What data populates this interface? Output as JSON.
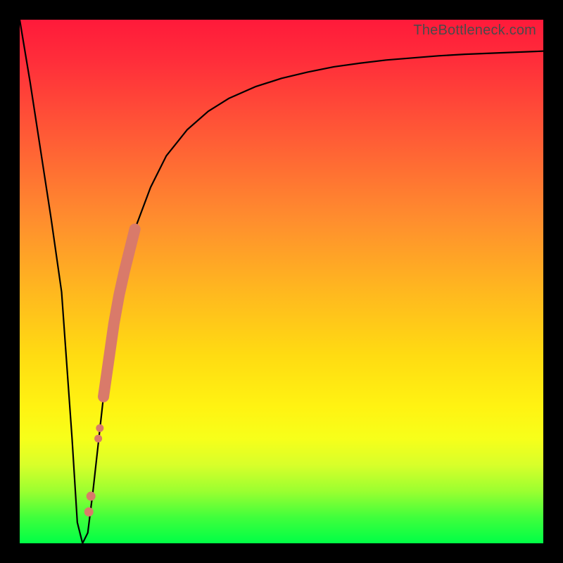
{
  "attribution": "TheBottleneck.com",
  "chart_data": {
    "type": "line",
    "title": "",
    "xlabel": "",
    "ylabel": "",
    "xlim": [
      0,
      100
    ],
    "ylim": [
      0,
      100
    ],
    "series": [
      {
        "name": "bottleneck-curve",
        "x": [
          0,
          2,
          4,
          6,
          8,
          10,
          11,
          12,
          13,
          14,
          16,
          18,
          20,
          22,
          25,
          28,
          32,
          36,
          40,
          45,
          50,
          55,
          60,
          65,
          70,
          75,
          80,
          85,
          90,
          95,
          100
        ],
        "y": [
          100,
          88,
          75,
          62,
          48,
          20,
          4,
          0,
          2,
          10,
          28,
          42,
          52,
          60,
          68,
          74,
          79,
          82.5,
          85,
          87.2,
          88.8,
          90,
          91,
          91.7,
          92.3,
          92.7,
          93.1,
          93.4,
          93.6,
          93.8,
          94
        ]
      }
    ],
    "highlight_points": {
      "name": "highlighted-range",
      "color": "#d97a6a",
      "points": [
        {
          "x": 13.2,
          "y": 6
        },
        {
          "x": 13.6,
          "y": 9
        },
        {
          "x": 15.0,
          "y": 20
        },
        {
          "x": 15.3,
          "y": 22
        },
        {
          "x": 16.0,
          "y": 28
        },
        {
          "x": 17.0,
          "y": 35
        },
        {
          "x": 18.0,
          "y": 42
        },
        {
          "x": 19.0,
          "y": 47.5
        },
        {
          "x": 20.0,
          "y": 52
        },
        {
          "x": 21.0,
          "y": 56
        },
        {
          "x": 22.0,
          "y": 60
        }
      ]
    }
  }
}
